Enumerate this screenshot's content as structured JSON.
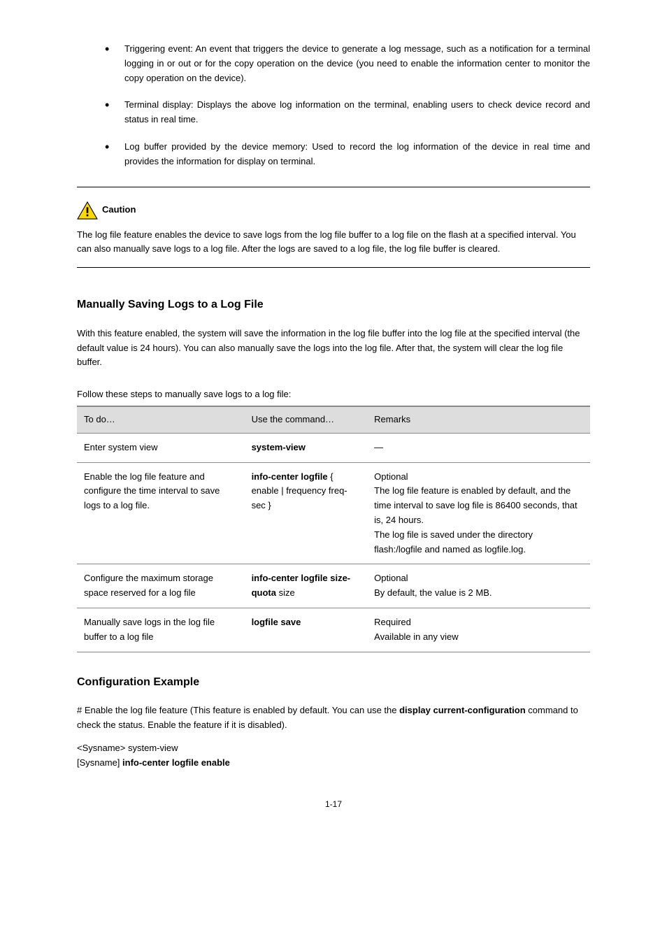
{
  "bullets": [
    "Triggering event: An event that triggers the device to generate a log message, such as a notification for a terminal logging in or out or for the copy operation on the device (you need to enable the information center to monitor the copy operation on the device).",
    "Terminal display: Displays the above log information on the terminal, enabling users to check device record and status in real time.",
    "Log buffer provided by the device memory: Used to record the log information of the device in real time and provides the information for display on terminal."
  ],
  "caution": {
    "label": "Caution",
    "text": "The log file feature enables the device to save logs from the log file buffer to a log file on the flash at a specified interval. You can also manually save logs to a log file. After the logs are saved to a log file, the log file buffer is cleared."
  },
  "section": {
    "heading": "Manually Saving Logs to a Log File",
    "desc": "With this feature enabled, the system will save the information in the log file buffer into the log file at the specified interval (the default value is 24 hours). You can also manually save the logs into the log file. After that, the system will clear the log file buffer.",
    "table_caption": "Follow these steps to manually save logs to a log file:",
    "table": {
      "headers": [
        "To do…",
        "Use the command…",
        "Remarks"
      ],
      "rows": [
        {
          "c1": "Enter system view",
          "c2_bold": "system-view",
          "c2_rest": "",
          "c3": "—"
        },
        {
          "c1": "Enable the log file feature and configure the time interval to save logs to a log file.",
          "c2_bold": "info-center logfile",
          "c2_rest": " { enable | frequency freq-sec }",
          "c3": "Optional\nThe log file feature is enabled by default, and the time interval to save log file is 86400 seconds, that is, 24 hours.\nThe log file is saved under the directory flash:/logfile and named as logfile.log."
        },
        {
          "c1": "Configure the maximum storage space reserved for a log file",
          "c2_bold": "info-center logfile size-quota",
          "c2_rest": " size",
          "c3": "Optional\nBy default, the value is 2 MB."
        },
        {
          "c1": "Manually save logs in the log file buffer to a log file",
          "c2_bold": "logfile save",
          "c2_rest": "",
          "c3": "Required\nAvailable in any view"
        }
      ]
    }
  },
  "example": {
    "heading": "Configuration Example",
    "line1_prefix": "# Enable the log file feature (This feature is enabled by default. You can use the ",
    "line1_bold": "display current-configuration",
    "line1_suffix": " command to check the status. Enable the feature if it is disabled).",
    "code1_pre": "<Sysname> system-view\n[Sysname] ",
    "code1_bold": "info-center logfile enable"
  },
  "page_number": "1-17"
}
